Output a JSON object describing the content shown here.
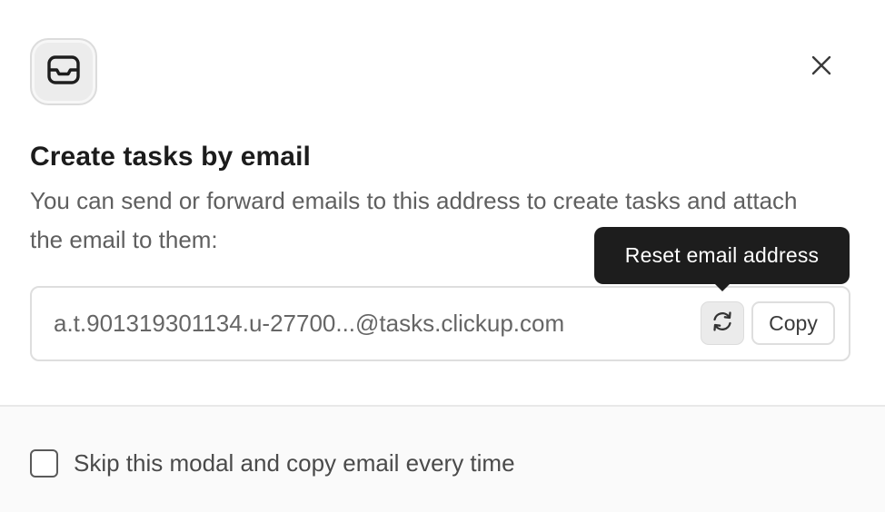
{
  "modal": {
    "icon": "envelope-icon",
    "close_icon": "close-icon",
    "title": "Create tasks by email",
    "description": "You can send or forward emails to this address to create tasks and attach the email to them:",
    "email_address": "a.t.901319301134.u-27700...@tasks.clickup.com",
    "reset_icon": "refresh-icon",
    "copy_label": "Copy",
    "tooltip": "Reset email address",
    "skip_checkbox": {
      "label": "Skip this modal and copy email every time",
      "checked": false
    }
  },
  "colors": {
    "tooltip_bg": "#1d1d1d",
    "footer_bg": "#fafafa",
    "border": "#dedede"
  }
}
